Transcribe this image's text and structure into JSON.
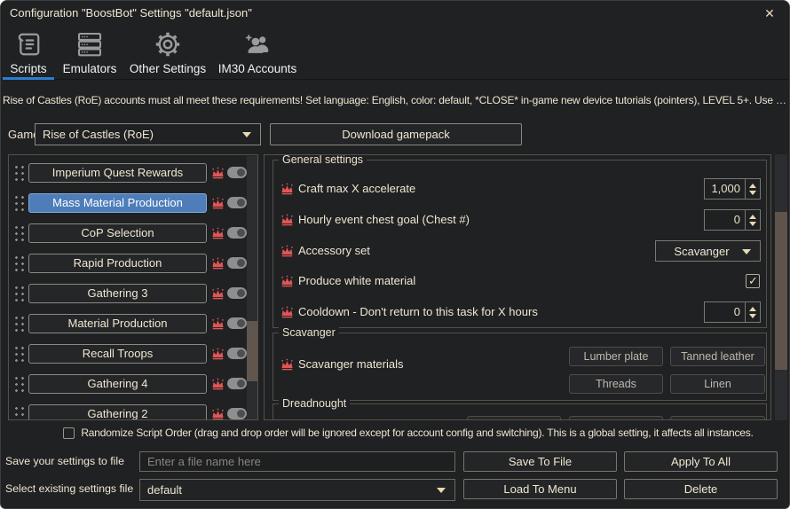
{
  "window": {
    "title": "Configuration \"BoostBot\" Settings \"default.json\"",
    "close_glyph": "✕"
  },
  "tabs": [
    {
      "label": "Scripts",
      "icon": "scroll-icon",
      "selected": true
    },
    {
      "label": "Emulators",
      "icon": "server-stack-icon",
      "selected": false
    },
    {
      "label": "Other Settings",
      "icon": "gear-icon",
      "selected": false
    },
    {
      "label": "IM30 Accounts",
      "icon": "add-users-icon",
      "selected": false
    }
  ],
  "notice": "Rise of Castles (RoE) accounts must all meet these requirements! Set language: English, color: default, *CLOSE* in-game new device tutorials (pointers), LEVEL 5+. Use L...",
  "game_row": {
    "label": "Game:",
    "selected_game": "Rise of Castles (RoE)",
    "download_button": "Download gamepack"
  },
  "script_list": {
    "items": [
      {
        "label": "Imperium Quest Rewards",
        "selected": false,
        "toggle_on": false
      },
      {
        "label": "Mass Material Production",
        "selected": true,
        "toggle_on": false
      },
      {
        "label": "CoP Selection",
        "selected": false,
        "toggle_on": false
      },
      {
        "label": "Rapid Production",
        "selected": false,
        "toggle_on": false
      },
      {
        "label": "Gathering 3",
        "selected": false,
        "toggle_on": false
      },
      {
        "label": "Material Production",
        "selected": false,
        "toggle_on": false
      },
      {
        "label": "Recall Troops",
        "selected": false,
        "toggle_on": false
      },
      {
        "label": "Gathering 4",
        "selected": false,
        "toggle_on": false
      },
      {
        "label": "Gathering 2",
        "selected": false,
        "toggle_on": false
      }
    ]
  },
  "settings": {
    "general": {
      "title": "General settings",
      "rows": [
        {
          "label": "Craft max X accelerate",
          "control": "spinner",
          "value": "1,000"
        },
        {
          "label": "Hourly event chest goal (Chest #)",
          "control": "spinner",
          "value": "0"
        },
        {
          "label": "Accessory set",
          "control": "dropdown",
          "value": "Scavanger"
        },
        {
          "label": "Produce white material",
          "control": "checkbox",
          "checked": true
        },
        {
          "label": "Cooldown - Don't return to this task for X hours",
          "control": "spinner",
          "value": "0"
        }
      ]
    },
    "scavanger": {
      "title": "Scavanger",
      "label": "Scavanger materials",
      "buttons": [
        "Lumber plate",
        "Tanned leather",
        "Threads",
        "Linen"
      ]
    },
    "dreadnought": {
      "title": "Dreadnought"
    }
  },
  "footer": {
    "randomize_label": "Randomize Script Order (drag and drop order will be ignored except for account config and switching). This is a global setting, it affects all instances.",
    "randomize_checked": false,
    "save_row": {
      "label": "Save your settings to file",
      "input_placeholder": "Enter a file name here",
      "save_button": "Save To File",
      "apply_button": "Apply To All"
    },
    "select_row": {
      "label": "Select existing settings file",
      "selected_file": "default",
      "load_button": "Load To Menu",
      "delete_button": "Delete"
    }
  },
  "colors": {
    "window_bg": "#1f2123",
    "accent_blue": "#4e7db9",
    "tab_underline": "#2d7cd4",
    "crown_red": "#e25555",
    "cream_text": "#efe6d0",
    "group_border": "#53504a"
  }
}
